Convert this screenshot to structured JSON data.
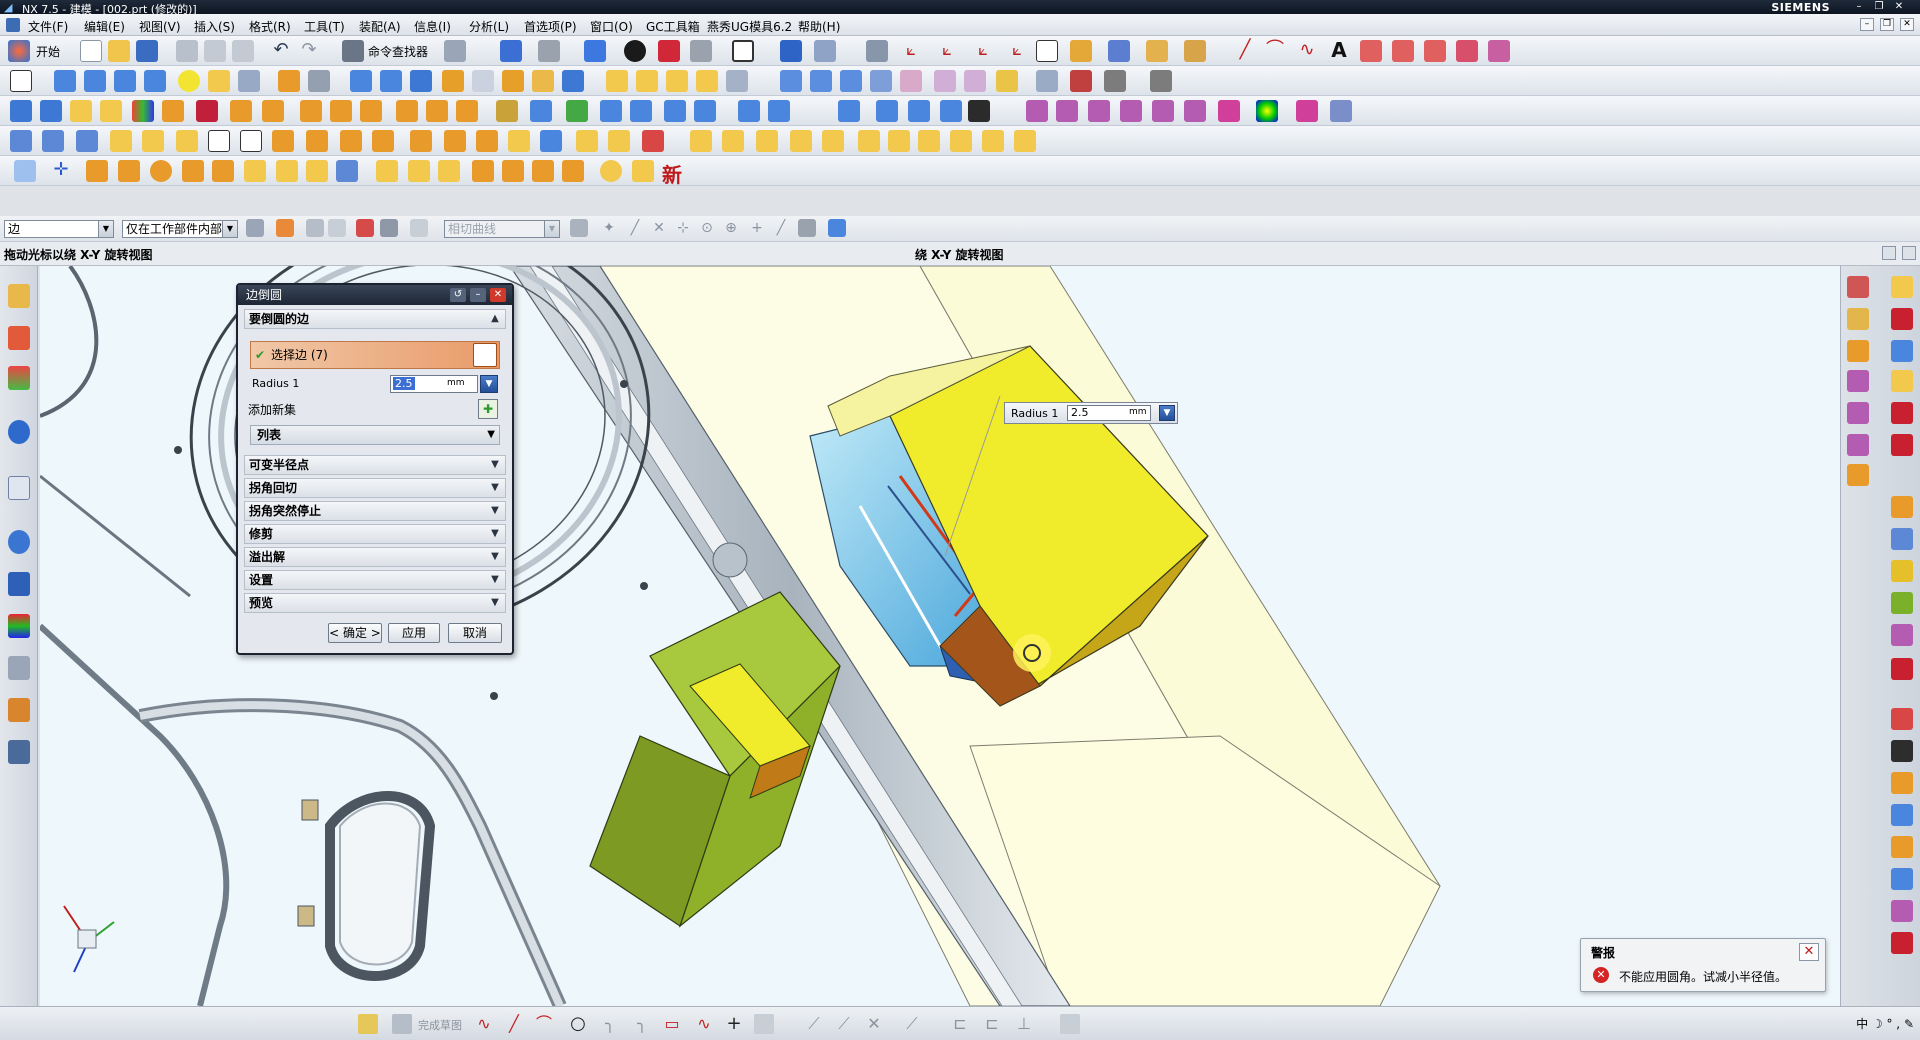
{
  "window": {
    "title": "NX 7.5 - 建模 - [002.prt (修改的)]",
    "brand": "SIEMENS",
    "controls": [
      "–",
      "❐",
      "✕"
    ]
  },
  "menubar": {
    "items": [
      "文件(F)",
      "编辑(E)",
      "视图(V)",
      "插入(S)",
      "格式(R)",
      "工具(T)",
      "装配(A)",
      "信息(I)",
      "分析(L)",
      "首选项(P)",
      "窗口(O)",
      "GC工具箱",
      "燕秀UG模具6.2",
      "帮助(H)"
    ]
  },
  "toolbar": {
    "start_label": "开始",
    "command_finder_label": "命令查找器",
    "more_label": "新"
  },
  "selection_bar": {
    "filter_value": "边",
    "scope_value": "仅在工作部件内部",
    "curve_rule_value": "相切曲线"
  },
  "cue_line": {
    "cue": "拖动光标以绕 X-Y 旋转视图",
    "status": "绕 X-Y 旋转视图"
  },
  "dialog": {
    "title": "边倒圆",
    "section_edges": "要倒圆的边",
    "select_edge_label": "选择边 (7)",
    "radius_label": "Radius 1",
    "radius_value": "2.5",
    "radius_unit": "mm",
    "add_new_set_label": "添加新集",
    "list_label": "列表",
    "sections": [
      "可变半径点",
      "拐角回切",
      "拐角突然停止",
      "修剪",
      "溢出解",
      "设置",
      "预览"
    ],
    "ok_label": "< 确定 >",
    "apply_label": "应用",
    "cancel_label": "取消"
  },
  "dynamic_input": {
    "label": "Radius 1",
    "value": "2.5",
    "unit": "mm"
  },
  "alert": {
    "title": "警报",
    "message": "不能应用圆角。试减小半径值。"
  },
  "bottom_toolbar": {
    "finish_sketch_label": "完成草图"
  },
  "tray": {
    "ime_label": "中 ☽ ° , ✎"
  },
  "colors": {
    "viewport_bg": "#eef7fb",
    "yellow_block": "#f0ec2c",
    "green_block": "#8fb12a",
    "dialog_highlight": "#e99a68",
    "alert_red": "#d42424"
  }
}
